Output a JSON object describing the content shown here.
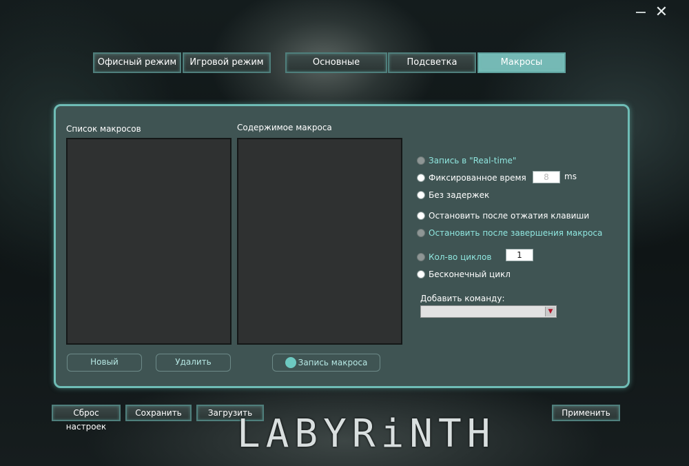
{
  "window": {
    "close_glyph": "✕"
  },
  "modes": [
    {
      "label": "Офисный режим"
    },
    {
      "label": "Игровой режим"
    }
  ],
  "tabs": [
    {
      "label": "Основные",
      "active": false
    },
    {
      "label": "Подсветка",
      "active": false
    },
    {
      "label": "Макросы",
      "active": true
    }
  ],
  "macros": {
    "list_title": "Список макросов",
    "content_title": "Содержимое макроса",
    "new_label": "Новый",
    "delete_label": "Удалить",
    "record_label": "Запись макроса"
  },
  "options": {
    "realtime": "Запись в \"Real-time\"",
    "fixed_time": "Фиксированное время",
    "fixed_time_value": "8",
    "fixed_time_unit": "ms",
    "no_delay": "Без задержек",
    "stop_on_release": "Остановить после отжатия клавиши",
    "stop_on_finish": "Остановить после завершения макроса",
    "cycles": "Кол-во циклов",
    "cycles_value": "1",
    "infinite": "Бесконечный цикл",
    "add_command": "Добавить команду:"
  },
  "footer": {
    "reset": "Сброс настроек",
    "save": "Сохранить",
    "load": "Загрузить",
    "apply": "Применить"
  },
  "brand": {
    "logo_text": "LABYRiNTH"
  },
  "colors": {
    "accent": "#75b9b5",
    "panel": "#3f5453",
    "panel_border": "#6fbdb6",
    "accent_text": "#8fe6df"
  }
}
